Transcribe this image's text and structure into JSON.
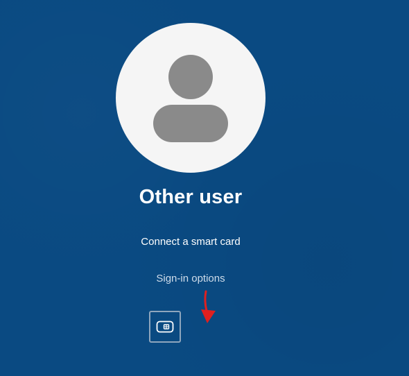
{
  "user": {
    "name": "Other user",
    "avatar_icon": "person-silhouette-icon"
  },
  "actions": {
    "connect_smart_card": "Connect a smart card",
    "sign_in_options": "Sign-in options"
  },
  "sign_in_methods": [
    {
      "icon": "smart-card-icon",
      "selected": true
    }
  ],
  "colors": {
    "background": "#0a4a82",
    "avatar_bg": "#f5f5f5",
    "avatar_silhouette": "#8a8a8a",
    "annotation_arrow": "#e0201f"
  }
}
